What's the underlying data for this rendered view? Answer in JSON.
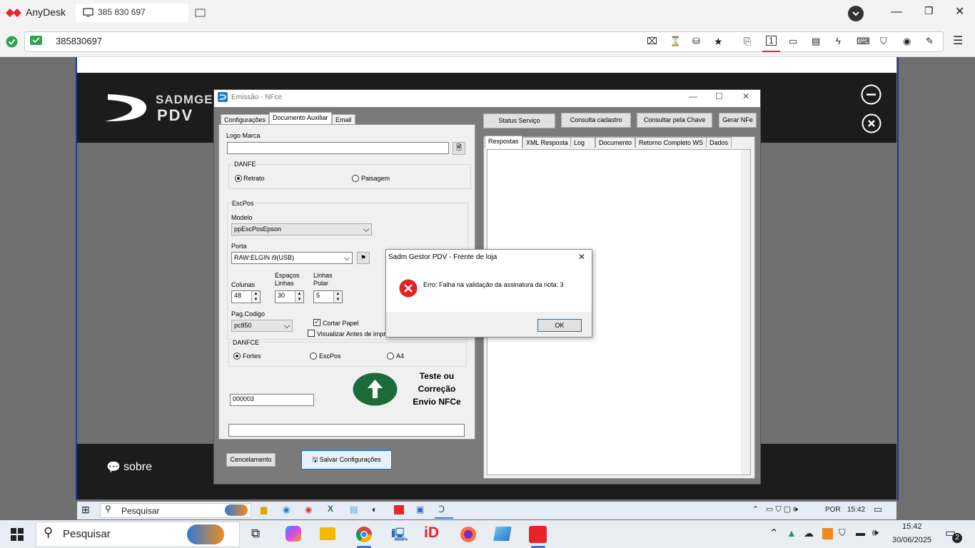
{
  "anydesk": {
    "brand": "AnyDesk",
    "tab_label": "385 830 697",
    "address": "385830697"
  },
  "remote": {
    "app_name_top": "SADMGES",
    "app_name_bottom": "PDV",
    "sobre": "sobre"
  },
  "window": {
    "title": "Emissão - NFce",
    "tabs": [
      "Configurações",
      "Documento Auxiliar",
      "Email"
    ],
    "logo_marca_label": "Logo Marca",
    "danfe_label": "DANFE",
    "danfe_options": [
      "Retrato",
      "Paisagem"
    ],
    "escpos_label": "EscPos",
    "modelo_label": "Modelo",
    "modelo_value": "ppEscPosEpson",
    "porta_label": "Porta",
    "porta_value": "RAW:ELGIN i9(USB)",
    "colunas_label": "Colunas",
    "colunas_value": "48",
    "espacos_label_1": "Espaços",
    "espacos_label_2": "Linhas",
    "espacos_value": "30",
    "linhas_label_1": "Linhas",
    "linhas_label_2": "Pular",
    "linhas_value": "5",
    "pagcodigo_label": "Pag.Codigo",
    "pagcodigo_value": "pc850",
    "cortar_papel": "Cortar Papel",
    "visualizar": "Visualizar Antes de impr",
    "danfce_label": "DANFCE",
    "danfce_options": [
      "Fortes",
      "EscPos",
      "A4"
    ],
    "numero_value": "000003",
    "teste_text_1": "Teste ou",
    "teste_text_2": "Correção",
    "teste_text_3": "Envio NFCe",
    "cancelamento_button": "Cencelamento",
    "salvar_button": "Salvar Configurações",
    "top_buttons": [
      "Status Serviço",
      "Consulta cadastro",
      "Consultar pela Chave",
      "Gerar NFe"
    ],
    "right_tabs": [
      "Respostas",
      "XML Resposta",
      "Log",
      "Documento",
      "Retorno Completo WS",
      "Dados"
    ]
  },
  "dialog": {
    "title": "Sadm Gestor PDV - Frente de loja",
    "message": "Erro: Falha na validação da assinatura da nota: 3",
    "ok": "OK"
  },
  "inner_taskbar": {
    "search": "Pesquisar",
    "lang": "POR",
    "time": "15:42"
  },
  "outer_taskbar": {
    "search": "Pesquisar",
    "time": "15:42",
    "date": "30/06/2025",
    "notifications": "2"
  },
  "colors": {
    "accent_red": "#e8242a",
    "sadm_green": "#1e6b3a",
    "selection_blue": "#0078d7"
  }
}
